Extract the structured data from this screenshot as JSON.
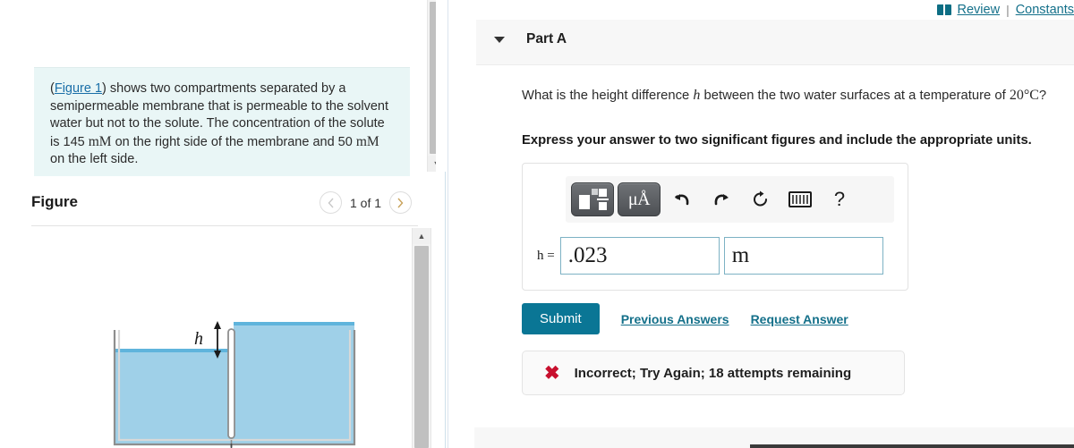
{
  "left": {
    "problem": {
      "link_text": "Figure 1",
      "before_link": "(",
      "after_link": ") shows two compartments separated by a semipermeable membrane that is permeable to the solvent water but not to the solute. The concentration of the solute is 145 ",
      "unit1": "mM",
      "mid": " on the right side of the membrane and 50 ",
      "unit2": "mM",
      "end": " on the left side."
    },
    "figure_title": "Figure",
    "figure_nav": {
      "prev_icon": "chevron-left-icon",
      "next_icon": "chevron-right-icon",
      "counter": "1 of 1"
    },
    "diagram": {
      "height_label": "h",
      "water_color": "#92c9e5",
      "water_color_top": "#6fb8dd",
      "wall_color": "#9a9a9a"
    }
  },
  "right": {
    "topbar": {
      "book_icon": "book-icon",
      "review_label": "Review",
      "separator": "|",
      "constants_label": "Constants"
    },
    "part": {
      "caret_icon": "caret-down-icon",
      "label": "Part A"
    },
    "question": {
      "text_a": "What is the height difference ",
      "symbol": "h",
      "text_b": " between the two water surfaces at a temperature of ",
      "temperature": "20°C",
      "text_c": "?",
      "instruction": "Express your answer to two significant figures and include the appropriate units."
    },
    "toolbar": {
      "template_icon": "math-template-icon",
      "units_label": "μÅ",
      "units_icon": "units-icon",
      "undo_icon": "undo-icon",
      "redo_icon": "redo-icon",
      "reset_icon": "reset-icon",
      "keyboard_icon": "keyboard-icon",
      "help_icon": "help-question-icon"
    },
    "answer": {
      "label": "h =",
      "value": ".023",
      "value_placeholder": "",
      "units": "m",
      "units_placeholder": ""
    },
    "actions": {
      "submit_label": "Submit",
      "previous_answers_label": "Previous Answers",
      "request_answer_label": "Request Answer"
    },
    "feedback": {
      "icon": "x-mark-icon",
      "text": "Incorrect; Try Again; 18 attempts remaining",
      "color": "#c8102e"
    }
  },
  "colors": {
    "accent": "#0a7695",
    "link": "#14708a",
    "problem_bg": "#e9f6f6",
    "error": "#c8102e",
    "input_border": "#7db2c4"
  }
}
